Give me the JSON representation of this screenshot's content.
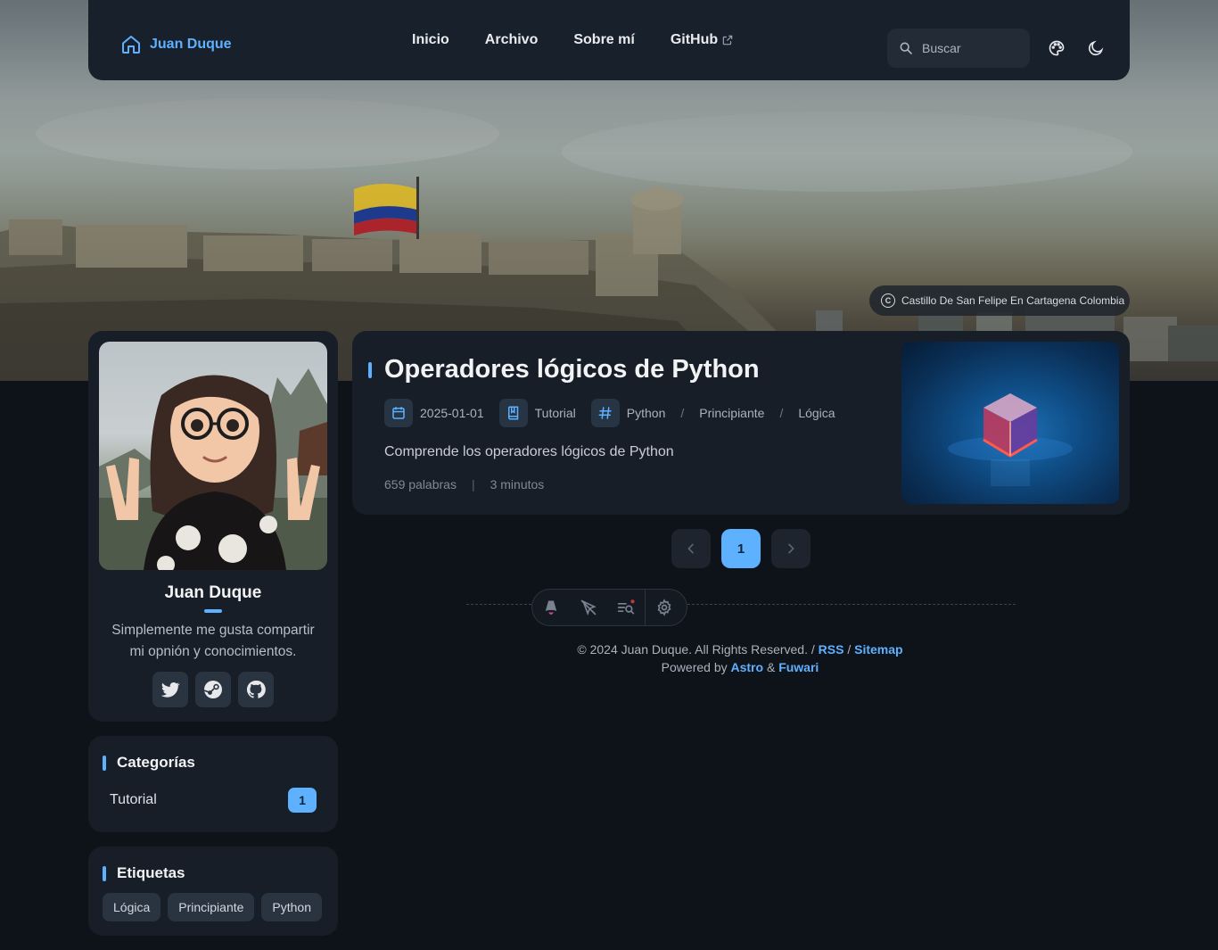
{
  "nav": {
    "brand": "Juan Duque",
    "links": [
      {
        "label": "Inicio"
      },
      {
        "label": "Archivo"
      },
      {
        "label": "Sobre mí"
      },
      {
        "label": "GitHub"
      }
    ],
    "search_placeholder": "Buscar"
  },
  "banner": {
    "credit": "Castillo De San Felipe En Cartagena Colombia"
  },
  "profile": {
    "name": "Juan Duque",
    "bio": "Simplemente me gusta compartir mi opnión y conocimientos.",
    "socials": [
      {
        "icon": "twitter-icon"
      },
      {
        "icon": "steam-icon"
      },
      {
        "icon": "github-icon"
      }
    ]
  },
  "categories": {
    "title": "Categorías",
    "items": [
      {
        "label": "Tutorial",
        "count": "1"
      }
    ]
  },
  "tags": {
    "title": "Etiquetas",
    "items": [
      "Lógica",
      "Principiante",
      "Python"
    ]
  },
  "post": {
    "title": "Operadores lógicos de Python",
    "date": "2025-01-01",
    "category": "Tutorial",
    "tags": [
      "Python",
      "Principiante",
      "Lógica"
    ],
    "tag_separator": "/",
    "description": "Comprende los operadores lógicos de Python",
    "words": "659 palabras",
    "stats_separator": "|",
    "read_time": "3 minutos"
  },
  "pagination": {
    "current": "1"
  },
  "footer": {
    "copyright": "© 2024 Juan Duque. All Rights Reserved. /",
    "rss": "RSS",
    "slash": "/",
    "sitemap": "Sitemap",
    "powered_by": "Powered by",
    "astro": "Astro",
    "amp": "&",
    "fuwari": "Fuwari"
  },
  "colors": {
    "accent": "#5eb1ff",
    "background": "#0e1219",
    "card": "#181e27"
  }
}
